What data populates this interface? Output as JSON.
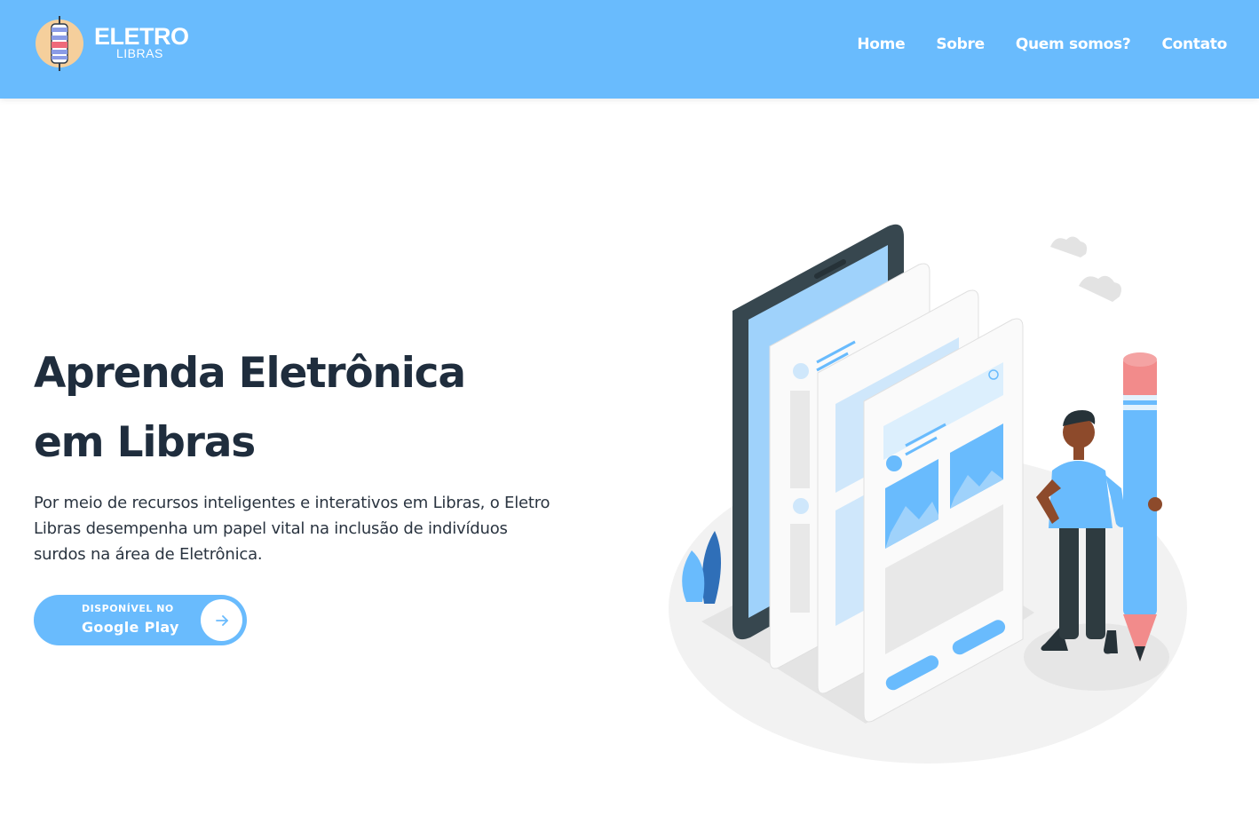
{
  "header": {
    "brand_title": "ELETRO",
    "brand_subtitle": "LIBRAS",
    "nav": [
      {
        "label": "Home"
      },
      {
        "label": "Sobre"
      },
      {
        "label": "Quem somos?"
      },
      {
        "label": "Contato"
      }
    ]
  },
  "hero": {
    "title_line1": "Aprenda Eletrônica",
    "title_line2": "em Libras",
    "description": "Por meio de recursos inteligentes e interativos em Libras, o Eletro Libras desempenha um papel vital na inclusão de indivíduos surdos na área de Eletrônica.",
    "cta": {
      "top_label": "DISPONÍVEL NO",
      "main_label": "Google Play"
    }
  },
  "colors": {
    "primary": "#69bbfd",
    "text_dark": "#1f2d3d",
    "background": "#ffffff"
  },
  "icons": {
    "logo": "resistor-logo-icon",
    "cta_arrow": "arrow-right-icon"
  }
}
